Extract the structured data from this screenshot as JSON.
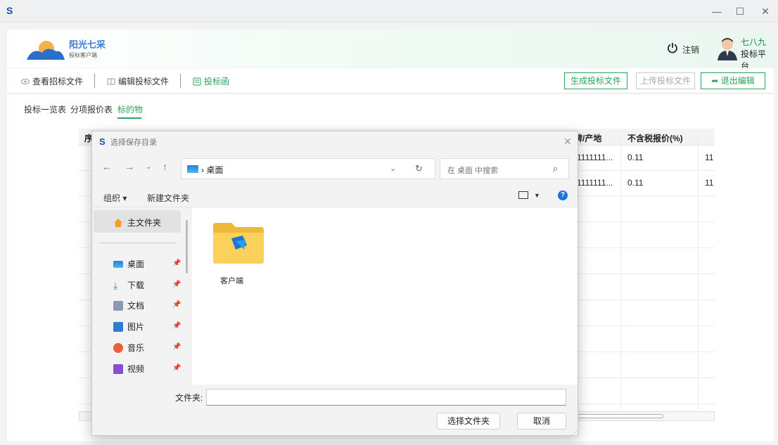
{
  "window": {
    "app_icon": "S",
    "minimize": "—",
    "maximize": "☐",
    "close": "✕"
  },
  "header": {
    "brand": "阳光七采",
    "brand_sub": "投标客户端",
    "logout": "注销",
    "user_name": "七八九",
    "user_platform": "投标平台"
  },
  "toolbar": {
    "tabs": [
      "查看招标文件",
      "编辑投标文件",
      "投标函"
    ],
    "buttons": [
      "生成投标文件",
      "上传投标文件",
      "退出编辑"
    ]
  },
  "subtabs": [
    "投标一览表",
    "分项报价表",
    "标的物"
  ],
  "table": {
    "headers": [
      "序",
      "牌/产地",
      "不含税报价(%)"
    ],
    "rows": [
      [
        "1111111...",
        "0.11",
        "11"
      ],
      [
        "1111111...",
        "0.11",
        "11"
      ]
    ]
  },
  "dialog": {
    "title": "选择保存目录",
    "address": "桌面",
    "search_placeholder": "在 桌面 中搜索",
    "organize": "组织 ▾",
    "new_folder": "新建文件夹",
    "nav_items": [
      {
        "label": "主文件夹",
        "icon": "home-icon",
        "color": "#f0a020"
      },
      {
        "label": "桌面",
        "icon": "desktop-icon",
        "color": "#2a88d8"
      },
      {
        "label": "下载",
        "icon": "download-icon",
        "color": "#2a88d8"
      },
      {
        "label": "文档",
        "icon": "document-icon",
        "color": "#8a9ab0"
      },
      {
        "label": "图片",
        "icon": "pictures-icon",
        "color": "#2a7fd4"
      },
      {
        "label": "音乐",
        "icon": "music-icon",
        "color": "#e8603a"
      },
      {
        "label": "视频",
        "icon": "video-icon",
        "color": "#8a4fd0"
      }
    ],
    "folder_name": "客户端",
    "filename_label": "文件夹:",
    "filename_value": "",
    "select_button": "选择文件夹",
    "cancel_button": "取消"
  },
  "colors": {
    "accent": "#2aa35d",
    "brand_blue": "#3d7fd0"
  }
}
